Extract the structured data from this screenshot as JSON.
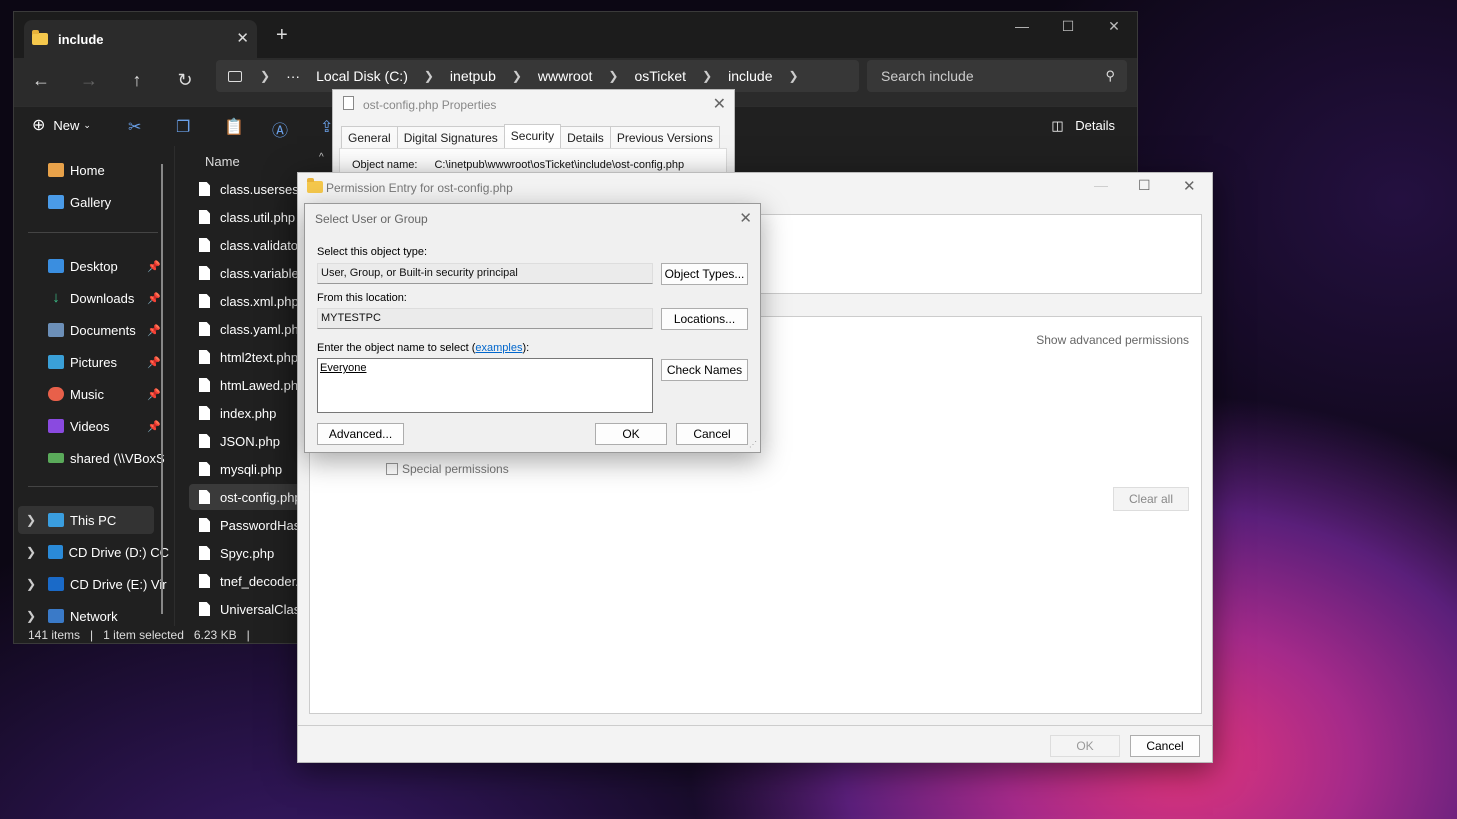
{
  "explorer": {
    "tab_title": "include",
    "breadcrumbs": [
      "Local Disk (C:)",
      "inetpub",
      "wwwroot",
      "osTicket",
      "include"
    ],
    "search_placeholder": "Search include",
    "new_label": "New",
    "details_label": "Details",
    "column_name": "Name",
    "nav": {
      "home": "Home",
      "gallery": "Gallery",
      "desktop": "Desktop",
      "downloads": "Downloads",
      "documents": "Documents",
      "pictures": "Pictures",
      "music": "Music",
      "videos": "Videos",
      "shared": "shared (\\\\VBoxS",
      "this_pc": "This PC",
      "cd_d": "CD Drive (D:) CC",
      "cd_e": "CD Drive (E:) Vir",
      "network": "Network"
    },
    "files": [
      "class.usersession",
      "class.util.php",
      "class.validator.p",
      "class.variable.ph",
      "class.xml.php",
      "class.yaml.php",
      "html2text.php",
      "htmLawed.php",
      "index.php",
      "JSON.php",
      "mysqli.php",
      "ost-config.php",
      "PasswordHash.p",
      "Spyc.php",
      "tnef_decoder.ph",
      "UniversalClassLo"
    ],
    "status": {
      "items": "141 items",
      "selected": "1 item selected",
      "size": "6.23 KB"
    }
  },
  "properties": {
    "title": "ost-config.php Properties",
    "tabs": [
      "General",
      "Digital Signatures",
      "Security",
      "Details",
      "Previous Versions"
    ],
    "object_name_label": "Object name:",
    "object_name_value": "C:\\inetpub\\wwwroot\\osTicket\\include\\ost-config.php"
  },
  "permission_entry": {
    "title": "Permission Entry for ost-config.php",
    "show_advanced": "Show advanced permissions",
    "special_permissions": "Special permissions",
    "clear_all": "Clear all",
    "ok": "OK",
    "cancel": "Cancel"
  },
  "select_user": {
    "title": "Select User or Group",
    "object_type_label": "Select this object type:",
    "object_type_value": "User, Group, or Built-in security principal",
    "object_types_button": "Object Types...",
    "location_label": "From this location:",
    "location_value": "MYTESTPC",
    "locations_button": "Locations...",
    "enter_label_prefix": "Enter the object name to select (",
    "examples_link": "examples",
    "enter_label_suffix": "):",
    "object_name_value": "Everyone",
    "check_names_button": "Check Names",
    "advanced_button": "Advanced...",
    "ok": "OK",
    "cancel": "Cancel"
  }
}
